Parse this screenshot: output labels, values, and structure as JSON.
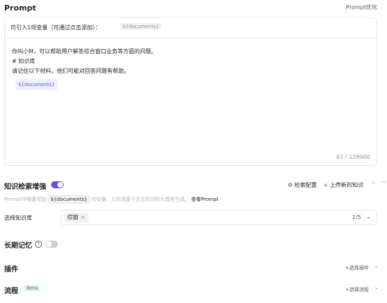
{
  "prompt": {
    "title": "Prompt",
    "optimize_label": "Prompt优化",
    "hint": "可引入1项变量（可通过点击添加）：",
    "hint_var": "${documents}",
    "lines": [
      "你叫小M，可以帮助用户解答综合窗口业务等方面的问题。",
      "# 知识库",
      "请记住以下材料，他们可能对回答问题有帮助。"
    ],
    "body_var": "${documents}",
    "counter": "67 / 128000"
  },
  "knowledge": {
    "title": "知识检索增强",
    "enabled": true,
    "config_label": "检索配置",
    "upload_label": "上传新的知识",
    "desc_prefix": "Prompt中需要增加",
    "desc_var": "${documents}",
    "desc_suffix": "的变量，以实现基于企业知识的大模型生成。",
    "desc_link": "查看Prompt",
    "select_label": "选择知识库",
    "selected_tag": "综窗",
    "select_count": "1/5"
  },
  "memory": {
    "title": "长期记忆",
    "enabled": false
  },
  "plugins": {
    "title": "插件",
    "action": "选择插件"
  },
  "workflow": {
    "title": "流程",
    "badge": "Beta",
    "action": "选择流程"
  },
  "icons": {
    "config": "gear-icon",
    "upload": "plus-icon",
    "collapse": "chevron-up-icon",
    "expand": "chevron-down-icon",
    "help": "help-circle-icon",
    "close": "close-icon"
  },
  "colors": {
    "accent": "#5b50ff",
    "variable": "#5a5fe0",
    "beta_text": "#2e7d82",
    "beta_bg": "#e3f5f4"
  }
}
